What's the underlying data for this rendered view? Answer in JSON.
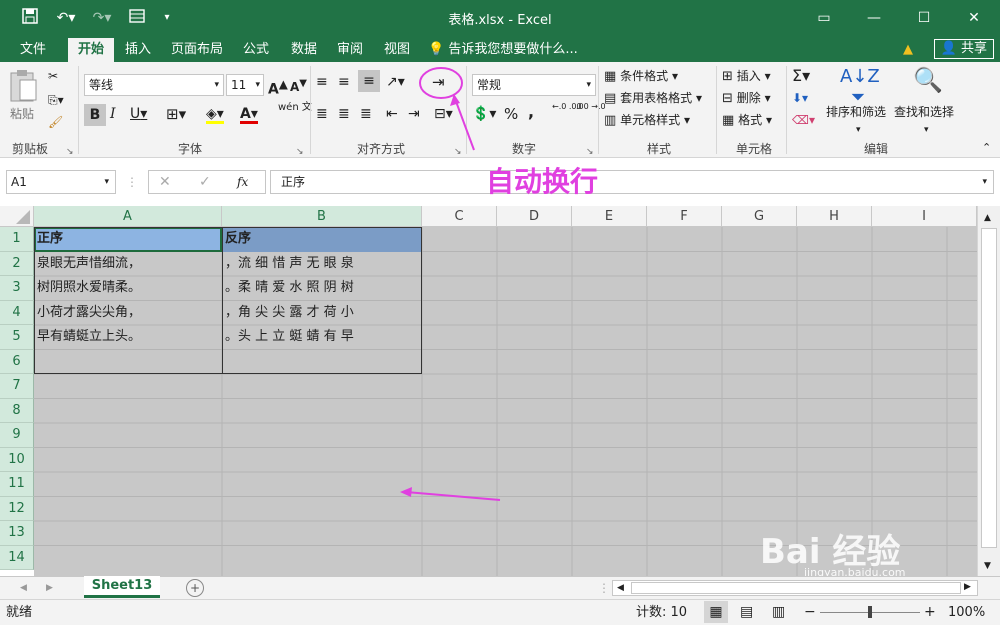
{
  "title_bar": {
    "doc_title": "表格.xlsx - Excel",
    "save_icon": "save-icon",
    "undo_icon": "undo-icon",
    "redo_icon": "redo-icon",
    "form_icon": "form-icon",
    "customize_icon": "customize-icon",
    "window_buttons": [
      "ribbon-display-icon",
      "minimize-icon",
      "maximize-icon",
      "close-icon"
    ]
  },
  "tabs": {
    "items": [
      "文件",
      "开始",
      "插入",
      "页面布局",
      "公式",
      "数据",
      "审阅",
      "视图"
    ],
    "active": "开始",
    "tell_me": "告诉我您想要做什么...",
    "share": "共享"
  },
  "ribbon": {
    "clipboard": {
      "paste": "粘贴",
      "label": "剪贴板"
    },
    "font": {
      "name": "等线",
      "size": "11",
      "label": "字体",
      "bold": "B",
      "italic": "I",
      "underline": "U",
      "grow": "A",
      "shrink": "A",
      "pinyin": "wén 文",
      "font_color_letter": "A"
    },
    "alignment": {
      "label": "对齐方式"
    },
    "number": {
      "format": "常规",
      "label": "数字",
      "percent": "%",
      "comma": ",",
      "inc_decimal": "←.0 .00",
      "dec_decimal": ".00 →.0"
    },
    "styles": {
      "conditional": "条件格式",
      "table": "套用表格格式",
      "cell": "单元格样式",
      "label": "样式"
    },
    "cells": {
      "insert": "插入",
      "delete": "删除",
      "format": "格式",
      "label": "单元格"
    },
    "editing": {
      "sort": "排序和筛选",
      "find": "查找和选择",
      "label": "编辑",
      "sum": "Σ"
    }
  },
  "formula_bar": {
    "name_box": "A1",
    "fx": "fx",
    "content": "正序"
  },
  "annotation": {
    "text": "自动换行"
  },
  "grid": {
    "columns": [
      "A",
      "B",
      "C",
      "D",
      "E",
      "F",
      "G",
      "H",
      "I"
    ],
    "rows": [
      "1",
      "2",
      "3",
      "4",
      "5",
      "6",
      "7",
      "8",
      "9",
      "10",
      "11",
      "12",
      "13",
      "14"
    ],
    "col_a": [
      "正序",
      "泉眼无声惜细流，",
      "树阴照水爱晴柔。",
      "小荷才露尖尖角，",
      "早有蜻蜓立上头。"
    ],
    "col_b": [
      "反序",
      "，流 细 惜 声 无 眼 泉",
      "。柔 晴 爱 水 照 阴 树",
      "，角 尖 尖 露 才 荷 小",
      "。头 上 立 蜓 蜻 有 早"
    ],
    "header_fill": "#8db4e2",
    "gray_fill": "#c8c8c8"
  },
  "sheets": {
    "tabs": [
      "Sheet13"
    ],
    "add": "+"
  },
  "status": {
    "ready": "就绪",
    "count": "计数: 10",
    "zoom": "100%",
    "zoom_fraction": 0.5
  },
  "watermark": {
    "text": "Bai 经验",
    "sub": "jingyan.baidu.com"
  }
}
